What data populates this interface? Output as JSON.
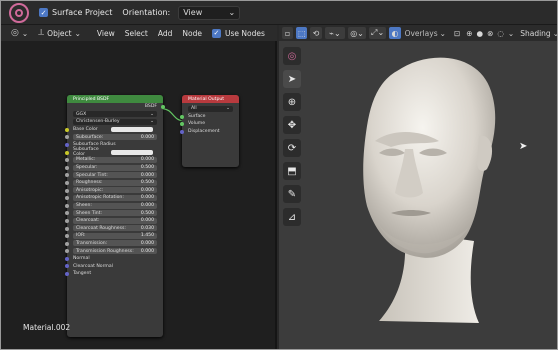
{
  "topbar": {
    "surface_project_label": "Surface Project",
    "orientation_label": "Orientation:",
    "orientation_value": "View"
  },
  "node_header": {
    "object_label": "Object",
    "menu": [
      "View",
      "Select",
      "Add",
      "Node"
    ],
    "use_nodes_label": "Use Nodes"
  },
  "viewport_header": {
    "overlays_label": "Overlays",
    "shading_label": "Shading"
  },
  "bsdf_node": {
    "title": "Principled BSDF",
    "output_label": "BSDF",
    "distribution": "GGX",
    "subsurface_method": "Christensen-Burley",
    "rows": [
      {
        "label": "Base Color",
        "value": ""
      },
      {
        "label": "Subsurface:",
        "value": "0.000"
      },
      {
        "label": "Subsurface Radius",
        "value": ""
      },
      {
        "label": "Subsurface Color",
        "value": ""
      },
      {
        "label": "Metallic:",
        "value": "0.000"
      },
      {
        "label": "Specular:",
        "value": "0.500"
      },
      {
        "label": "Specular Tint:",
        "value": "0.000"
      },
      {
        "label": "Roughness:",
        "value": "0.500"
      },
      {
        "label": "Anisotropic:",
        "value": "0.000"
      },
      {
        "label": "Anisotropic Rotation:",
        "value": "0.000"
      },
      {
        "label": "Sheen:",
        "value": "0.000"
      },
      {
        "label": "Sheen Tint:",
        "value": "0.500"
      },
      {
        "label": "Clearcoat:",
        "value": "0.000"
      },
      {
        "label": "Clearcoat Roughness:",
        "value": "0.030"
      },
      {
        "label": "IOR:",
        "value": "1.450"
      },
      {
        "label": "Transmission:",
        "value": "0.000"
      },
      {
        "label": "Transmission Roughness:",
        "value": "0.000"
      },
      {
        "label": "Normal",
        "value": ""
      },
      {
        "label": "Clearcoat Normal",
        "value": ""
      },
      {
        "label": "Tangent",
        "value": ""
      }
    ]
  },
  "output_node": {
    "title": "Material Output",
    "target": "All",
    "inputs": [
      "Surface",
      "Volume",
      "Displacement"
    ]
  },
  "material_name": "Material.002",
  "colors": {
    "accent": "#4d78c4",
    "bsdf_header": "#3f8a3f",
    "output_header": "#b83a3e",
    "head_skin": "#e8e4dd"
  }
}
